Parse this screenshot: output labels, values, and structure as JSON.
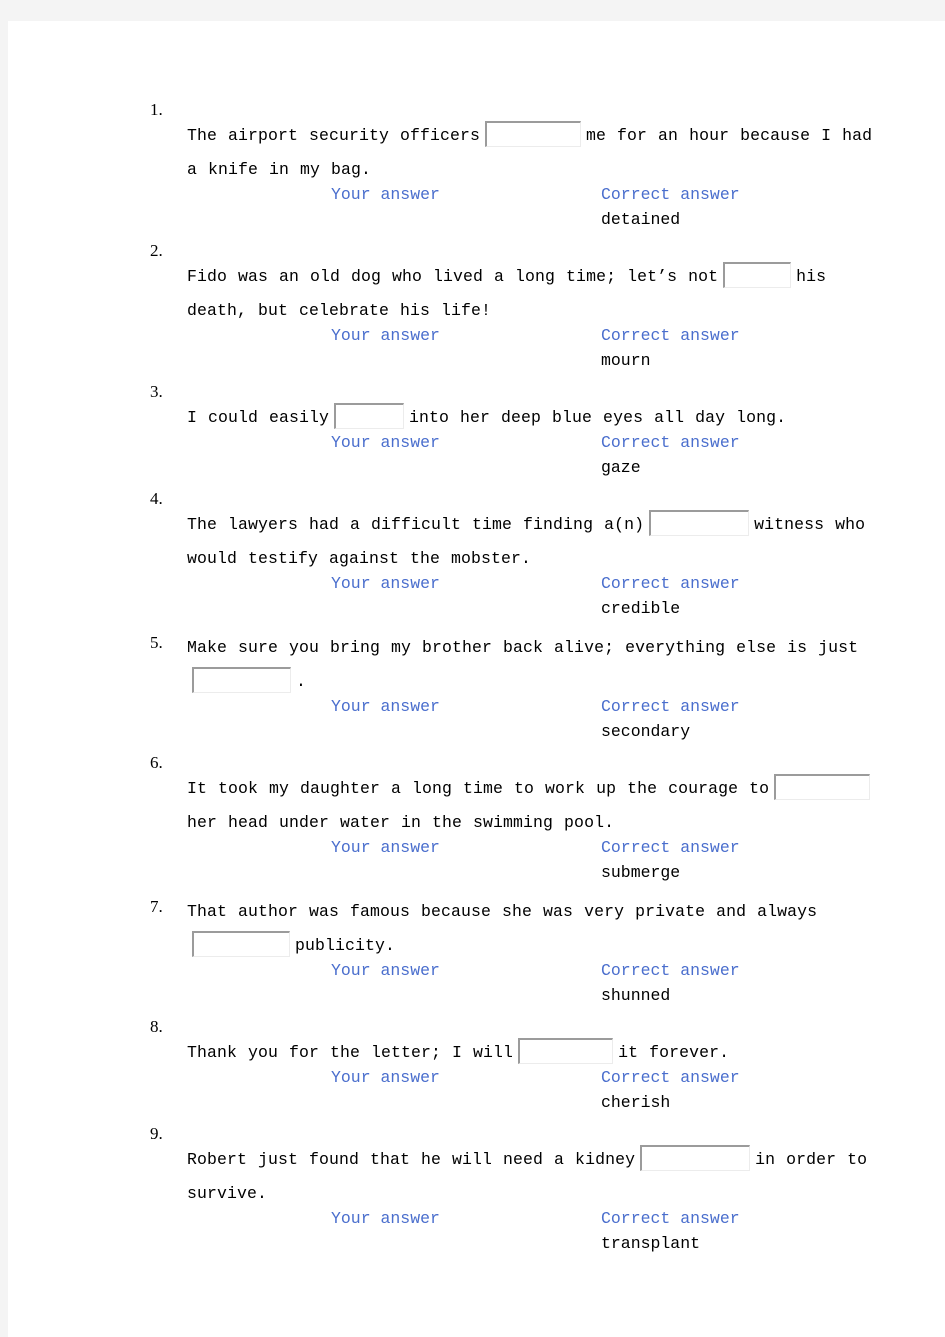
{
  "colors": {
    "canvas": "#f4f4f4",
    "page": "#ffffff",
    "label_blue": "#4a6ecd",
    "text_black": "#000000",
    "box_border_dark": "#9b9b9b",
    "box_border_light": "#ececec"
  },
  "labels": {
    "your_answer": "Your answer",
    "correct_answer": "Correct answer"
  },
  "questions": [
    {
      "number": "1.",
      "number_style": "hanging",
      "prompt_before": "The airport security officers",
      "prompt_after": "me for an hour because I had a knife in my bag.",
      "blank_width": 96,
      "your_answer": "",
      "correct_answer": "detained"
    },
    {
      "number": "2.",
      "number_style": "hanging",
      "prompt_before": "Fido was an old dog who lived a long time; let’s not",
      "prompt_after": "his death, but celebrate his life!",
      "blank_width": 68,
      "your_answer": "",
      "correct_answer": "mourn"
    },
    {
      "number": "3.",
      "number_style": "hanging",
      "prompt_before": "I could easily",
      "prompt_after": "into her deep blue eyes all day long.",
      "blank_width": 70,
      "your_answer": "",
      "correct_answer": "gaze"
    },
    {
      "number": "4.",
      "number_style": "hanging",
      "prompt_before": "The lawyers had a difficult time finding a(n)",
      "prompt_after": "witness who would testify against the mobster.",
      "blank_width": 100,
      "your_answer": "",
      "correct_answer": "credible"
    },
    {
      "number": "5.",
      "number_style": "inline",
      "prompt_before": "Make sure you bring my brother back alive; everything else is just",
      "prompt_after": ".",
      "blank_width": 99,
      "your_answer": "",
      "correct_answer": "secondary"
    },
    {
      "number": "6.",
      "number_style": "hanging",
      "prompt_before": "It took my daughter a long time to work up the courage to",
      "prompt_after": "her head under water in the swimming pool.",
      "blank_width": 96,
      "your_answer": "",
      "correct_answer": "submerge"
    },
    {
      "number": "7.",
      "number_style": "inline",
      "prompt_before": "That author was famous because she was very private and always",
      "prompt_after": "publicity.",
      "blank_width": 98,
      "your_answer": "",
      "correct_answer": "shunned"
    },
    {
      "number": "8.",
      "number_style": "hanging",
      "prompt_before": "Thank you for the letter; I will",
      "prompt_after": "it forever.",
      "blank_width": 95,
      "your_answer": "",
      "correct_answer": "cherish"
    },
    {
      "number": "9.",
      "number_style": "hanging",
      "prompt_before": "Robert just found that he will need a kidney",
      "prompt_after": "in order to survive.",
      "blank_width": 110,
      "your_answer": "",
      "correct_answer": "transplant"
    }
  ]
}
